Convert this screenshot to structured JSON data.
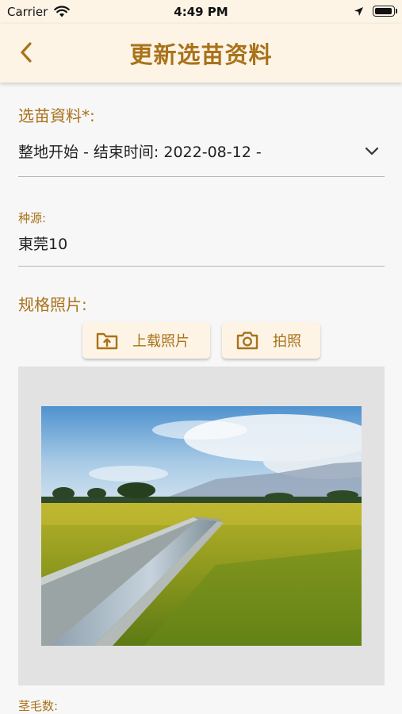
{
  "status_bar": {
    "carrier": "Carrier",
    "time": "4:49 PM",
    "wifi_icon": "wifi-icon",
    "location_icon": "location-arrow-icon",
    "battery_icon": "battery-icon"
  },
  "nav": {
    "title": "更新选苗资料",
    "back_icon": "chevron-left-icon"
  },
  "form": {
    "seedling_label": "选苗資料*:",
    "seedling_value": "整地开始 - 结束时间: 2022-08-12 -",
    "seed_source_label": "种源:",
    "seed_source_value": "東莞10",
    "photo_label": "规格照片:",
    "upload_button_label": "上载照片",
    "camera_button_label": "拍照",
    "upload_icon": "folder-upload-icon",
    "camera_icon": "camera-icon",
    "stem_count_label": "茎毛数:"
  },
  "colors": {
    "accent": "#a9721b",
    "header_bg": "#fdf4e6",
    "page_bg": "#f7f7f7",
    "photo_frame_bg": "#e2e2e2"
  }
}
